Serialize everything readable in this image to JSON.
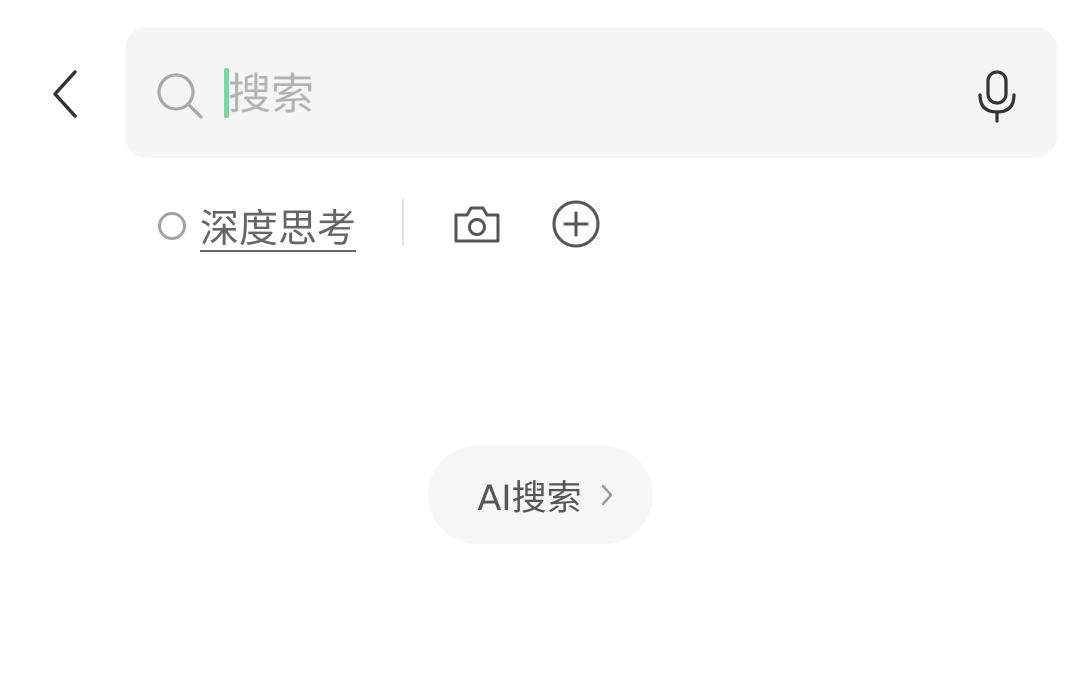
{
  "header": {
    "back_icon": "chevron-left-icon",
    "search": {
      "placeholder": "搜索",
      "value": "",
      "search_icon": "magnifier-icon",
      "voice_icon": "microphone-icon",
      "cursor_color": "#7fd5a0"
    }
  },
  "toolbar": {
    "deep_think": {
      "label": "深度思考",
      "checked": false
    },
    "camera_icon": "camera-icon",
    "add_icon": "plus-circle-icon"
  },
  "main": {
    "ai_search": {
      "label": "AI搜索",
      "chevron_icon": "chevron-right-icon"
    }
  },
  "colors": {
    "background": "#ffffff",
    "search_bar": "#f5f5f5",
    "accent_cursor": "#7fd5a0",
    "icon": "#333333",
    "muted_text": "#666666",
    "placeholder": "#b3b3b3"
  }
}
